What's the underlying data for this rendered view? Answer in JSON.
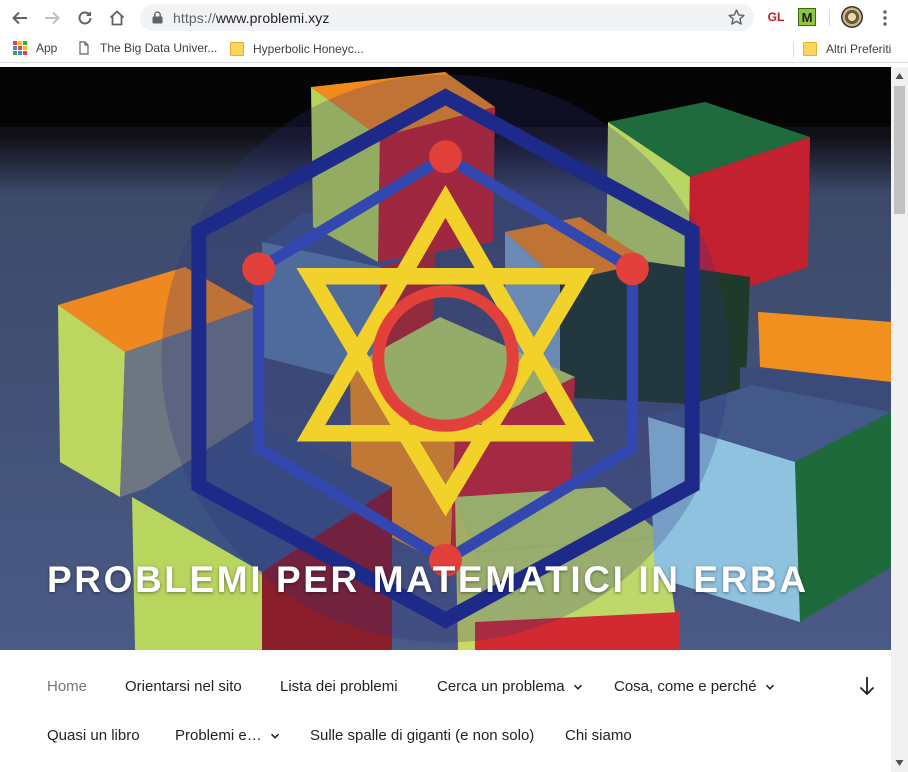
{
  "browser": {
    "url_scheme": "https://",
    "url_host": "www.problemi.xyz",
    "extensions": {
      "gl_label": "GL",
      "m_label": "M"
    }
  },
  "bookmarks": {
    "items": [
      {
        "label": "App",
        "icon": "apps-grid-icon"
      },
      {
        "label": "The Big Data Univer...",
        "icon": "page-icon"
      },
      {
        "label": "Hyperbolic Honeyc...",
        "icon": "folder-icon"
      }
    ],
    "other_label": "Altri Preferiti"
  },
  "site": {
    "title": "PROBLEMI PER MATEMATICI IN ERBA",
    "logo_icon": "polyhedron-logo-icon"
  },
  "menu": {
    "items": [
      {
        "label": "Home",
        "active": true,
        "has_submenu": false
      },
      {
        "label": "Orientarsi nel sito",
        "active": false,
        "has_submenu": false
      },
      {
        "label": "Lista dei problemi",
        "active": false,
        "has_submenu": false
      },
      {
        "label": "Cerca un problema",
        "active": false,
        "has_submenu": true
      },
      {
        "label": "Cosa, come e perché",
        "active": false,
        "has_submenu": true
      },
      {
        "label": "Quasi un libro",
        "active": false,
        "has_submenu": false
      },
      {
        "label": "Problemi e…",
        "active": false,
        "has_submenu": true
      },
      {
        "label": "Sulle spalle di giganti (e non solo)",
        "active": false,
        "has_submenu": false
      },
      {
        "label": "Chi siamo",
        "active": false,
        "has_submenu": false
      }
    ],
    "scroll_icon": "arrow-down-icon"
  },
  "colors": {
    "omnibox_bg": "#f1f3f4",
    "menu_text": "#222222",
    "menu_active": "#767676",
    "title_text": "#ffffff"
  }
}
